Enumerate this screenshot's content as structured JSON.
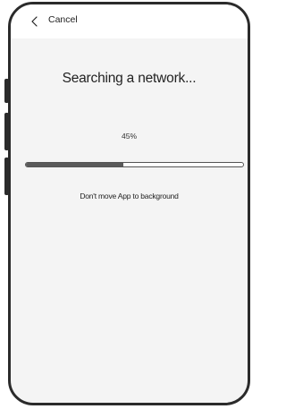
{
  "nav": {
    "back_icon": "chevron-left-icon",
    "cancel_label": "Cancel"
  },
  "main": {
    "title": "Searching a network...",
    "progress_text": "45%",
    "progress_value": 45,
    "warning": "Don't move App to background"
  },
  "colors": {
    "frame": "#2b2b2b",
    "screen_background": "#f4f4f4",
    "nav_background": "#ffffff",
    "progress_fill": "#5a5a5a",
    "progress_track": "#ffffff"
  }
}
